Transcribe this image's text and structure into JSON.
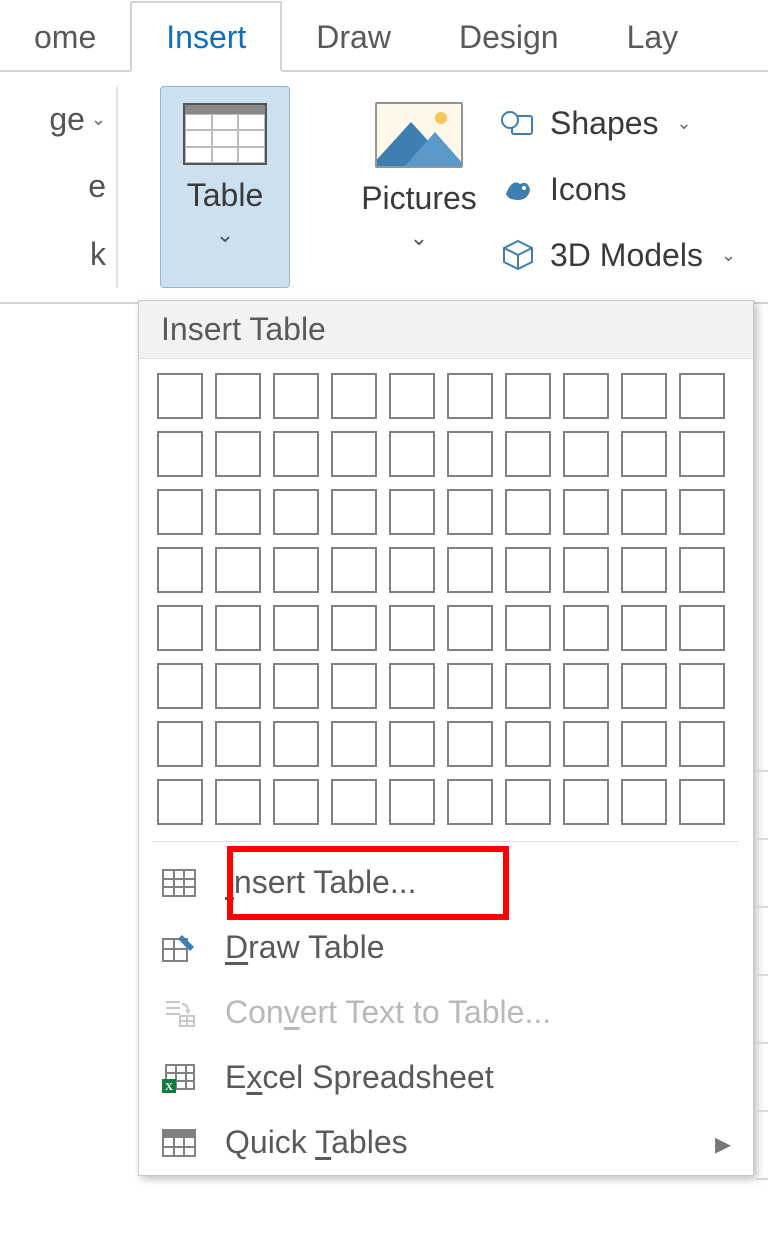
{
  "tabs": {
    "home": "ome",
    "insert": "Insert",
    "draw": "Draw",
    "design": "Design",
    "layout": "Lay"
  },
  "pages": {
    "line1": "ge",
    "line2": "e",
    "line3": "k"
  },
  "ribbon": {
    "table": "Table",
    "pictures": "Pictures",
    "shapes": "Shapes",
    "icons": "Icons",
    "models3d": "3D Models"
  },
  "dropdown": {
    "header": "Insert Table",
    "grid_cols": 10,
    "grid_rows": 8,
    "insert_table": "Insert Table...",
    "draw_table": "Draw Table",
    "convert": "Convert Text to Table...",
    "excel": "Excel Spreadsheet",
    "quick": "Quick Tables"
  },
  "highlight": "insert_table"
}
